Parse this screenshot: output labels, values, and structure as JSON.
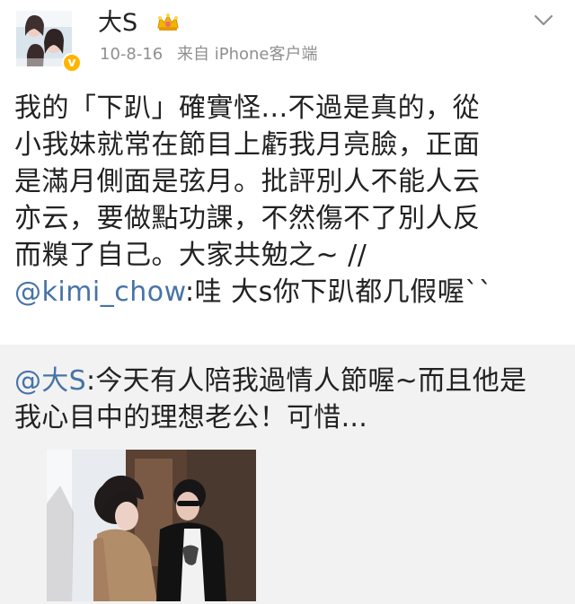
{
  "header": {
    "username": "大S",
    "timestamp": "10-8-16",
    "source": "来自 iPhone客户端",
    "verified_icon": "verified-badge-icon",
    "crown_icon": "crown-icon",
    "menu_icon": "chevron-down-icon"
  },
  "post": {
    "lines": [
      "我的「下趴」確實怪...不過是真的，從",
      "小我妹就常在節目上虧我月亮臉，正面",
      "是滿月側面是弦月。批評別人不能人云",
      "亦云，要做點功課，不然傷不了別人反",
      "而糗了自己。大家共勉之~ //"
    ],
    "reply_mention": "@kimi_chow",
    "reply_text": ":哇 大s你下趴都几假喔``"
  },
  "quoted": {
    "mention": "@大S",
    "line1": ":今天有人陪我過情人節喔~而且他是",
    "line2": "我心目中的理想老公！可惜..."
  },
  "colors": {
    "mention": "#4773a7",
    "meta": "#8f8f8f",
    "quote_bg": "#f2f2f2"
  }
}
